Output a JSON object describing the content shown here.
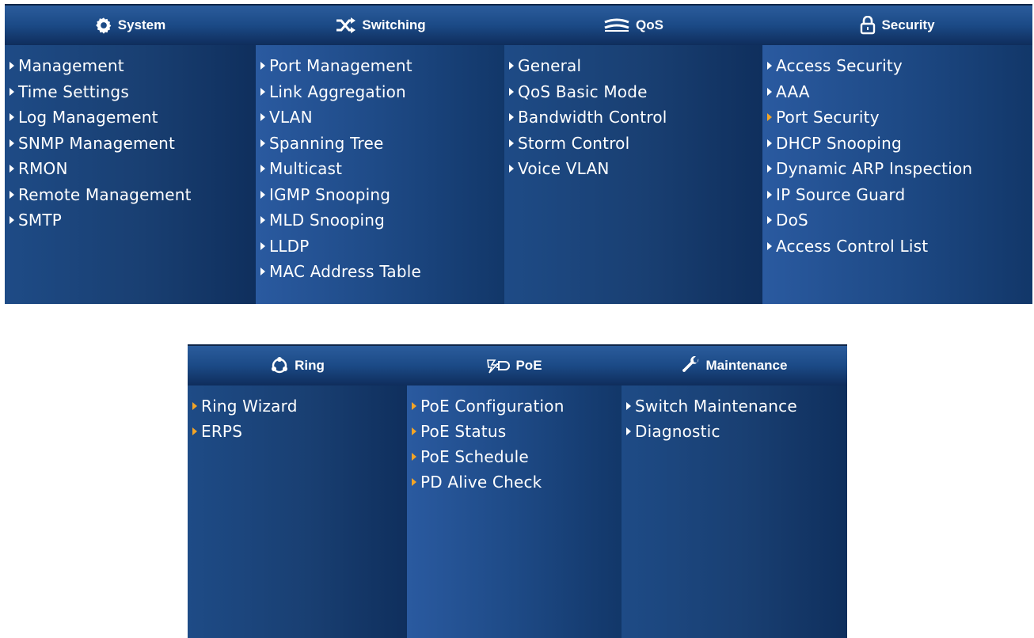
{
  "colors": {
    "arrow_default": "#ffffff",
    "arrow_highlight": "#f3a426",
    "header_bg": "#1b4a86"
  },
  "top_menu": [
    {
      "title": "System",
      "icon": "gear-icon",
      "items": [
        {
          "label": "Management"
        },
        {
          "label": "Time Settings"
        },
        {
          "label": "Log Management"
        },
        {
          "label": "SNMP Management"
        },
        {
          "label": "RMON"
        },
        {
          "label": "Remote Management"
        },
        {
          "label": "SMTP"
        }
      ]
    },
    {
      "title": "Switching",
      "icon": "switching-arrows-icon",
      "items": [
        {
          "label": "Port Management"
        },
        {
          "label": "Link Aggregation"
        },
        {
          "label": "VLAN"
        },
        {
          "label": "Spanning Tree"
        },
        {
          "label": "Multicast"
        },
        {
          "label": "IGMP Snooping"
        },
        {
          "label": "MLD Snooping"
        },
        {
          "label": "LLDP"
        },
        {
          "label": "MAC Address Table"
        }
      ]
    },
    {
      "title": "QoS",
      "icon": "qos-wave-icon",
      "items": [
        {
          "label": "General"
        },
        {
          "label": "QoS Basic Mode"
        },
        {
          "label": "Bandwidth Control"
        },
        {
          "label": "Storm Control"
        },
        {
          "label": "Voice VLAN"
        }
      ]
    },
    {
      "title": "Security",
      "icon": "padlock-icon",
      "items": [
        {
          "label": "Access Security"
        },
        {
          "label": "AAA"
        },
        {
          "label": "Port Security"
        },
        {
          "label": "DHCP Snooping"
        },
        {
          "label": "Dynamic ARP Inspection"
        },
        {
          "label": "IP Source Guard"
        },
        {
          "label": "DoS"
        },
        {
          "label": "Access Control List"
        }
      ]
    }
  ],
  "bottom_menu": [
    {
      "title": "Ring",
      "icon": "ring-icon",
      "items": [
        {
          "label": "Ring Wizard"
        },
        {
          "label": "ERPS"
        }
      ]
    },
    {
      "title": "PoE",
      "icon": "poe-plug-icon",
      "items": [
        {
          "label": "PoE Configuration"
        },
        {
          "label": "PoE Status"
        },
        {
          "label": "PoE Schedule"
        },
        {
          "label": "PD Alive Check"
        }
      ]
    },
    {
      "title": "Maintenance",
      "icon": "wrench-icon",
      "items": [
        {
          "label": "Switch Maintenance"
        },
        {
          "label": "Diagnostic"
        }
      ]
    }
  ]
}
